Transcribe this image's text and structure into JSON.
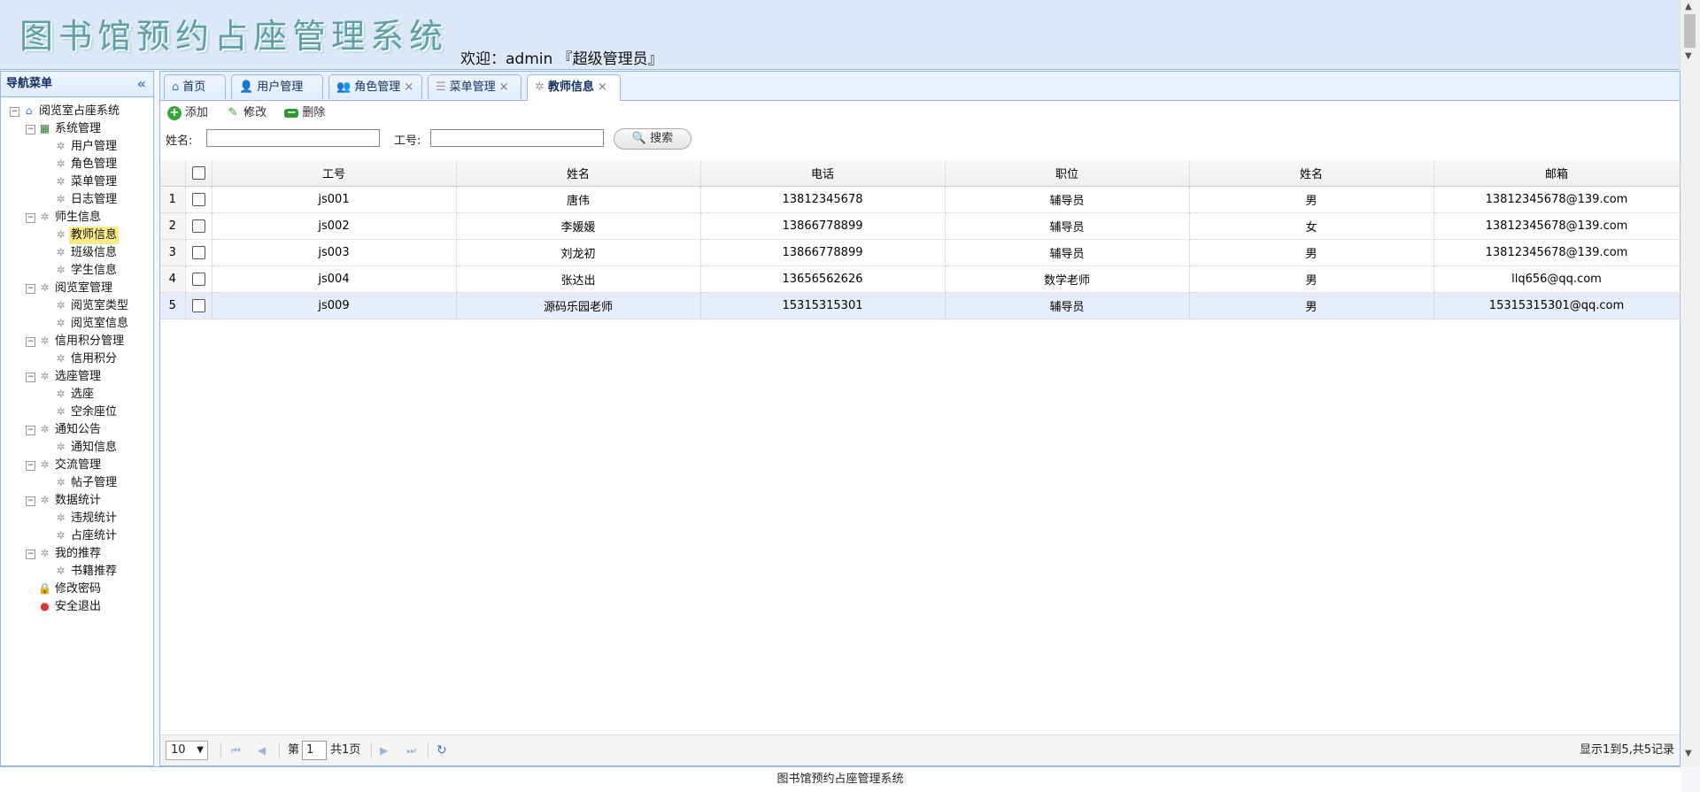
{
  "header": {
    "title": "图书馆预约占座管理系统",
    "welcome": "欢迎：admin 『超级管理员』"
  },
  "sidebar": {
    "title": "导航菜单",
    "collapse_icon": "double-chevron-left-icon",
    "root": "阅览室占座系统",
    "groups": [
      {
        "label": "系统管理",
        "items": [
          "用户管理",
          "角色管理",
          "菜单管理",
          "日志管理"
        ]
      },
      {
        "label": "师生信息",
        "items": [
          "教师信息",
          "班级信息",
          "学生信息"
        ]
      },
      {
        "label": "阅览室管理",
        "items": [
          "阅览室类型",
          "阅览室信息"
        ]
      },
      {
        "label": "信用积分管理",
        "items": [
          "信用积分"
        ]
      },
      {
        "label": "选座管理",
        "items": [
          "选座",
          "空余座位"
        ]
      },
      {
        "label": "通知公告",
        "items": [
          "通知信息"
        ]
      },
      {
        "label": "交流管理",
        "items": [
          "帖子管理"
        ]
      },
      {
        "label": "数据统计",
        "items": [
          "违规统计",
          "占座统计"
        ]
      },
      {
        "label": "我的推荐",
        "items": [
          "书籍推荐"
        ]
      }
    ],
    "extra": [
      "修改密码",
      "安全退出"
    ],
    "selected": "教师信息"
  },
  "tabs": [
    {
      "label": "首页",
      "icon": "home-icon",
      "closable": false
    },
    {
      "label": "用户管理",
      "icon": "user-icon",
      "closable": true
    },
    {
      "label": "角色管理",
      "icon": "role-icon",
      "closable": true
    },
    {
      "label": "菜单管理",
      "icon": "menu-icon",
      "closable": true
    },
    {
      "label": "教师信息",
      "icon": "gear-icon",
      "closable": true,
      "active": true
    }
  ],
  "toolbar": {
    "add": "添加",
    "edit": "修改",
    "delete": "删除"
  },
  "search": {
    "name_label": "姓名:",
    "id_label": "工号:",
    "button": "搜索"
  },
  "table": {
    "columns": [
      "工号",
      "姓名",
      "电话",
      "职位",
      "姓名",
      "邮箱"
    ],
    "rows": [
      {
        "n": "1",
        "id": "js001",
        "name": "唐伟",
        "phone": "13812345678",
        "pos": "辅导员",
        "sex": "男",
        "email": "13812345678@139.com"
      },
      {
        "n": "2",
        "id": "js002",
        "name": "李媛媛",
        "phone": "13866778899",
        "pos": "辅导员",
        "sex": "女",
        "email": "13812345678@139.com"
      },
      {
        "n": "3",
        "id": "js003",
        "name": "刘龙初",
        "phone": "13866778899",
        "pos": "辅导员",
        "sex": "男",
        "email": "13812345678@139.com"
      },
      {
        "n": "4",
        "id": "js004",
        "name": "张达出",
        "phone": "13656562626",
        "pos": "数学老师",
        "sex": "男",
        "email": "llq656@qq.com"
      },
      {
        "n": "5",
        "id": "js009",
        "name": "源码乐园老师",
        "phone": "15315315301",
        "pos": "辅导员",
        "sex": "男",
        "email": "15315315301@qq.com"
      }
    ],
    "selected_row": 5
  },
  "pager": {
    "page_size": "10",
    "page_prefix": "第",
    "page": "1",
    "page_total": "共1页",
    "info": "显示1到5,共5记录"
  },
  "footer": "图书馆预约占座管理系统",
  "colors": {
    "border": "#95b8e7",
    "header_bg": "#dde9f8",
    "selected": "#fbec88"
  }
}
